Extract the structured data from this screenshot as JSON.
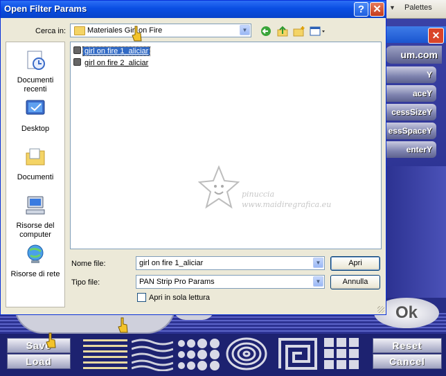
{
  "background_app": {
    "palettes_menu": "Palettes",
    "brand_text": "um.com",
    "param_buttons": [
      "Y",
      "aceY",
      "cessSizeY",
      "essSpaceY",
      "enterY"
    ],
    "ok_label": "Ok",
    "save_label": "Save",
    "load_label": "Load",
    "reset_label": "Reset",
    "cancel_label": "Cancel",
    "close_glyph": "✕"
  },
  "dialog": {
    "title": "Open Filter Params",
    "help_glyph": "?",
    "close_glyph": "✕",
    "look_in_label": "Cerca in:",
    "look_in_value": "Materiales Girl on Fire",
    "places": [
      {
        "label": "Documenti recenti",
        "icon": "recent-documents-icon"
      },
      {
        "label": "Desktop",
        "icon": "desktop-icon"
      },
      {
        "label": "Documenti",
        "icon": "my-documents-icon"
      },
      {
        "label": "Risorse del computer",
        "icon": "my-computer-icon"
      },
      {
        "label": "Risorse di rete",
        "icon": "network-icon"
      }
    ],
    "files": [
      {
        "name": "girl on fire 1_aliciar",
        "selected": true
      },
      {
        "name": "girl on fire 2_aliciar",
        "selected": false
      }
    ],
    "filename_label": "Nome file:",
    "filename_value": "girl on fire 1_aliciar",
    "filetype_label": "Tipo file:",
    "filetype_value": "PAN Strip Pro Params",
    "open_button": "Apri",
    "cancel_button": "Annulla",
    "readonly_label": "Apri in sola lettura",
    "readonly_checked": false
  },
  "watermark": {
    "line1": "pinuccia",
    "line2": "www.maidiregrafica.eu"
  }
}
